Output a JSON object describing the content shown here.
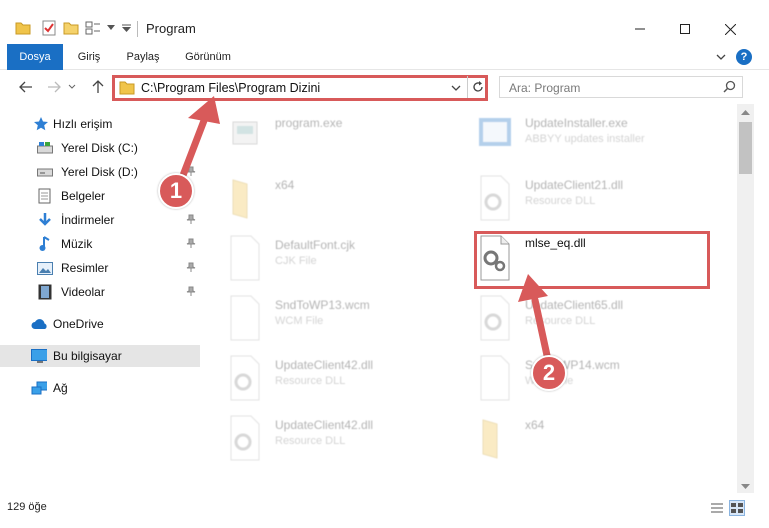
{
  "window": {
    "title": "Program"
  },
  "ribbon": {
    "tabs": [
      "Dosya",
      "Giriş",
      "Paylaş",
      "Görünüm"
    ],
    "help": "?"
  },
  "address": {
    "path": "C:\\Program Files\\Program Dizini",
    "search_placeholder": "Ara: Program"
  },
  "nav": {
    "items": [
      {
        "label": "Hızlı erişim",
        "icon": "star-icon"
      },
      {
        "label": "Yerel Disk (C:)",
        "icon": "drive-icon"
      },
      {
        "label": "Yerel Disk (D:)",
        "icon": "drive-icon"
      },
      {
        "label": "Belgeler",
        "icon": "documents-icon"
      },
      {
        "label": "İndirmeler",
        "icon": "download-icon"
      },
      {
        "label": "Müzik",
        "icon": "music-icon"
      },
      {
        "label": "Resimler",
        "icon": "pictures-icon"
      },
      {
        "label": "Videolar",
        "icon": "video-icon"
      },
      {
        "label": "OneDrive",
        "icon": "cloud-icon"
      },
      {
        "label": "Bu bilgisayar",
        "icon": "computer-icon"
      },
      {
        "label": "Ağ",
        "icon": "network-icon"
      }
    ]
  },
  "files": [
    {
      "name": "program.exe",
      "type": ""
    },
    {
      "name": "UpdateInstaller.exe",
      "type": "ABBYY updates installer"
    },
    {
      "name": "x64",
      "type": ""
    },
    {
      "name": "UpdateClient21.dll",
      "type": "Resource DLL"
    },
    {
      "name": "DefaultFont.cjk",
      "type": "CJK File"
    },
    {
      "name": "mlse_eq.dll",
      "type": ""
    },
    {
      "name": "SndToWP13.wcm",
      "type": "WCM File"
    },
    {
      "name": "UpdateClient65.dll",
      "type": "Resource DLL"
    },
    {
      "name": "UpdateClient42.dll",
      "type": "Resource DLL"
    },
    {
      "name": "SndToWP14.wcm",
      "type": "WCM File"
    },
    {
      "name": "UpdateClient42.dll",
      "type": "Resource DLL"
    },
    {
      "name": "x64",
      "type": ""
    }
  ],
  "status": {
    "count": "129 öğe"
  },
  "annotations": {
    "badge1": "1",
    "badge2": "2"
  },
  "colors": {
    "accent": "#1a6fc4",
    "annotation": "#d85a5a"
  }
}
